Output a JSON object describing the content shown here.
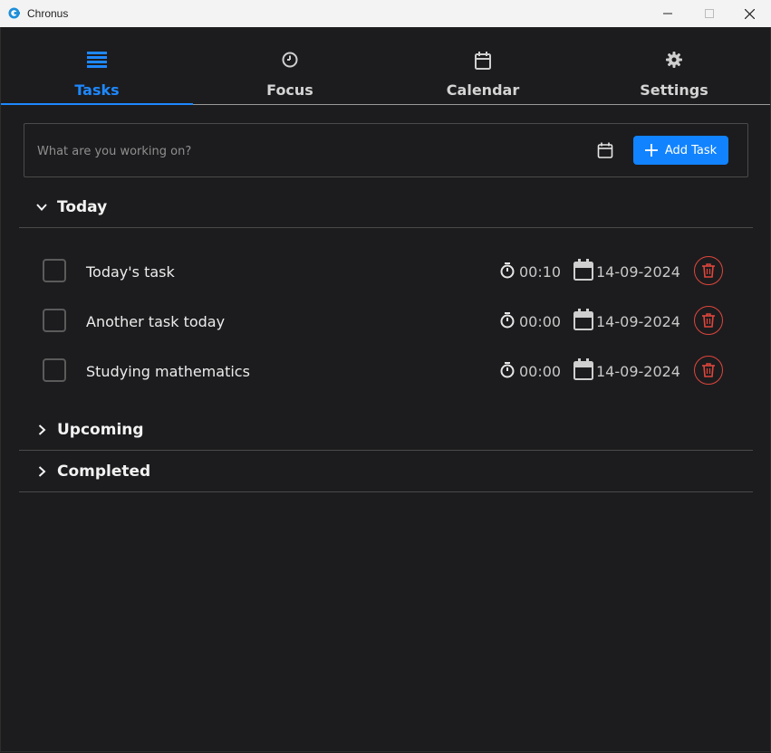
{
  "window": {
    "title": "Chronus"
  },
  "tabs": [
    {
      "label": "Tasks",
      "icon": "list-icon",
      "active": true
    },
    {
      "label": "Focus",
      "icon": "clock-icon",
      "active": false
    },
    {
      "label": "Calendar",
      "icon": "calendar-icon",
      "active": false
    },
    {
      "label": "Settings",
      "icon": "gear-icon",
      "active": false
    }
  ],
  "task_input": {
    "placeholder": "What are you working on?",
    "value": "",
    "add_label": "Add Task"
  },
  "sections": {
    "today": {
      "title": "Today",
      "expanded": true,
      "tasks": [
        {
          "name": "Today's task",
          "time": "00:10",
          "date": "14-09-2024",
          "done": false
        },
        {
          "name": "Another task today",
          "time": "00:00",
          "date": "14-09-2024",
          "done": false
        },
        {
          "name": "Studying mathematics",
          "time": "00:00",
          "date": "14-09-2024",
          "done": false
        }
      ]
    },
    "upcoming": {
      "title": "Upcoming",
      "expanded": false
    },
    "completed": {
      "title": "Completed",
      "expanded": false
    }
  },
  "colors": {
    "accent": "#1e88ff",
    "background": "#1c1c1e",
    "delete": "#e0463c"
  }
}
